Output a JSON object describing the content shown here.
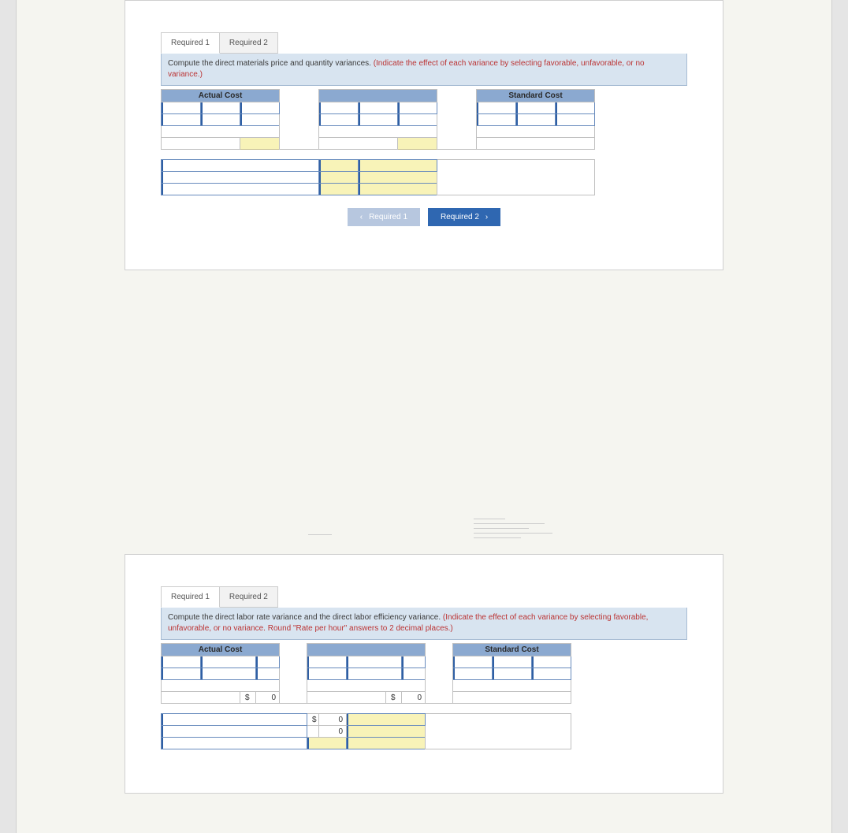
{
  "tabs": {
    "r1": "Required 1",
    "r2": "Required 2"
  },
  "card1": {
    "prompt_main": "Compute the direct materials price and quantity variances. ",
    "prompt_red": "(Indicate the effect of each variance by selecting favorable, unfavorable, or no variance.)",
    "hdr_actual": "Actual Cost",
    "hdr_standard": "Standard Cost"
  },
  "card2": {
    "prompt_main": "Compute the direct labor rate variance and the direct labor efficiency variance. ",
    "prompt_red": "(Indicate the effect of each variance by selecting favorable, unfavorable, or no variance. Round \"Rate per hour\" answers to 2 decimal places.)",
    "hdr_actual": "Actual Cost",
    "hdr_standard": "Standard Cost",
    "sym": "$",
    "zero": "0"
  },
  "nav": {
    "prev": "Required 1",
    "next": "Required 2"
  }
}
